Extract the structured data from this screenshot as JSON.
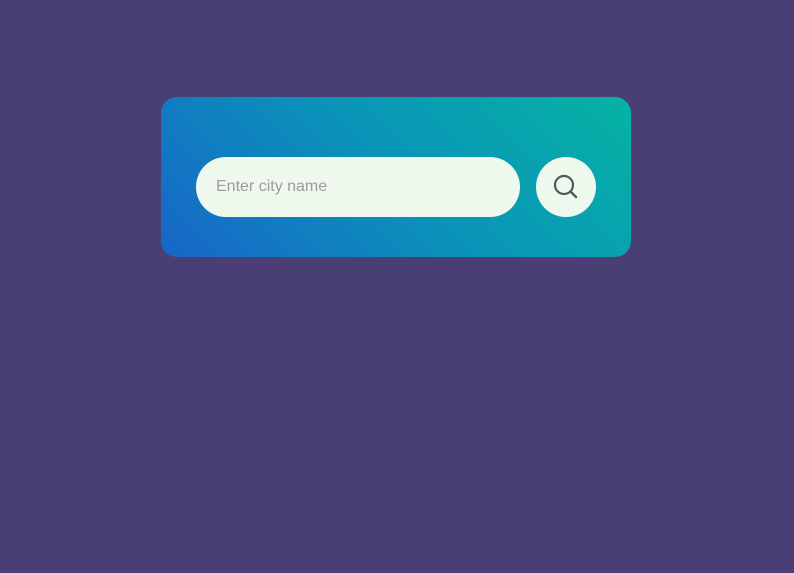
{
  "search": {
    "placeholder": "Enter city name",
    "value": "",
    "button_icon": "search-icon"
  },
  "colors": {
    "page_background": "#493f75",
    "card_gradient_start": "#1766c8",
    "card_gradient_end": "#05b3a3",
    "input_background": "#eff8ec",
    "icon_color": "#4f5a58"
  }
}
